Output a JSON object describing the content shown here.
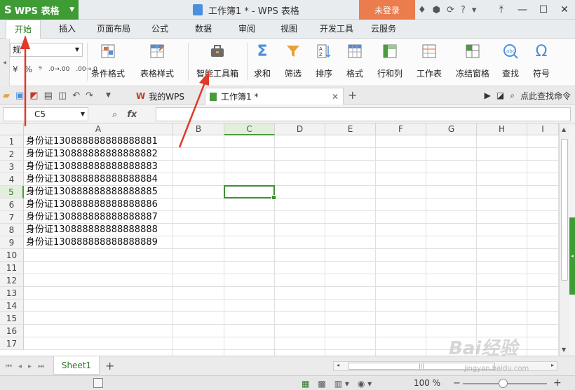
{
  "app": {
    "menu_label": "WPS 表格",
    "doc_title": "工作簿1 * - WPS 表格",
    "login_label": "未登录",
    "accent": "#3f9c35"
  },
  "tabs": [
    "开始",
    "插入",
    "页面布局",
    "公式",
    "数据",
    "审阅",
    "视图",
    "开发工具",
    "云服务"
  ],
  "ribbon": {
    "number_format": "规",
    "number_buttons": [
      "%",
      "⁹",
      ".0→.00",
      ".00→.0"
    ],
    "buttons": [
      "条件格式",
      "表格样式",
      "智能工具箱",
      "求和",
      "筛选",
      "排序",
      "格式",
      "行和列",
      "工作表",
      "冻结窗格",
      "查找",
      "符号"
    ]
  },
  "doc_tabs": {
    "home": "我的WPS",
    "book": "工作簿1 *",
    "search": "点此查找命令"
  },
  "formula_bar": {
    "cell_ref": "C5",
    "fx": "fx",
    "value": ""
  },
  "grid": {
    "columns": [
      "A",
      "B",
      "C",
      "D",
      "E",
      "F",
      "G",
      "H",
      "I"
    ],
    "rows": [
      1,
      2,
      3,
      4,
      5,
      6,
      7,
      8,
      9,
      10,
      11,
      12,
      13,
      14,
      15,
      16,
      17
    ],
    "active_col": "C",
    "active_row": 5,
    "cells_a": [
      "身份证130888888888888881",
      "身份证130888888888888882",
      "身份证130888888888888883",
      "身份证130888888888888884",
      "身份证130888888888888885",
      "身份证130888888888888886",
      "身份证130888888888888887",
      "身份证130888888888888888",
      "身份证130888888888888889"
    ]
  },
  "sheets": [
    "Sheet1"
  ],
  "status": {
    "zoom": "100 %"
  },
  "watermark": {
    "brand": "Bai经验",
    "url": "jingyan.baidu.com"
  }
}
